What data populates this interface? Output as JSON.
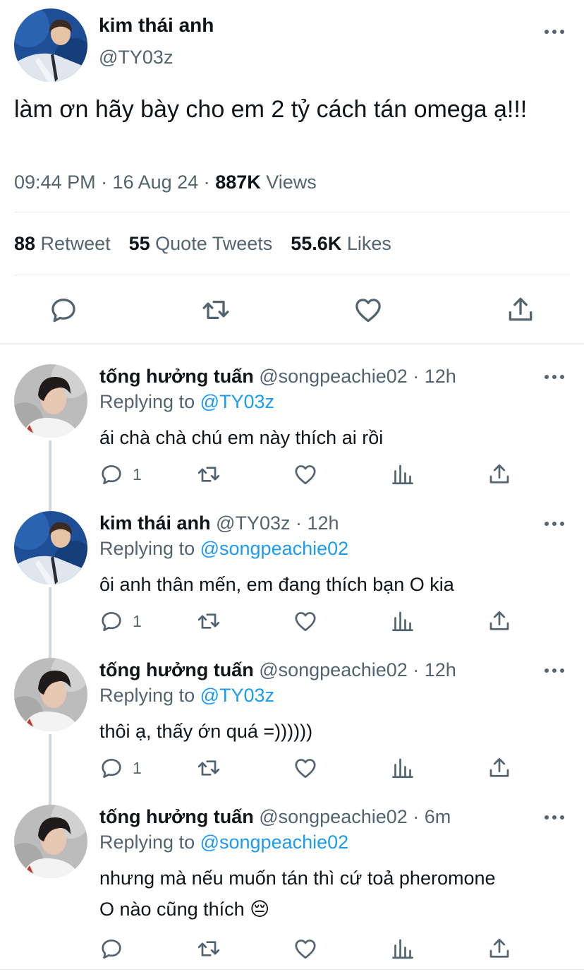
{
  "main_tweet": {
    "name": "kim thái anh",
    "handle": "@TY03z",
    "text": "làm ơn hãy bày cho em 2 tỷ cách tán omega ạ!!!",
    "time": "09:44 PM · 16 Aug 24 · ",
    "views_count": "887K",
    "views_label": " Views",
    "retweets_count": "88",
    "retweets_label": " Retweet",
    "quotes_count": "55",
    "quotes_label": " Quote Tweets",
    "likes_count": "55.6K",
    "likes_label": " Likes"
  },
  "replies": [
    {
      "name": "tống hưởng tuấn",
      "handle_time": " @songpeachie02 · 12h",
      "replying_prefix": "Replying to ",
      "replying_to": "@TY03z",
      "text": "ái chà chà chú em này thích ai rồi",
      "reply_count": "1"
    },
    {
      "name": "kim thái anh",
      "handle_time": " @TY03z · 12h",
      "replying_prefix": "Replying to ",
      "replying_to": "@songpeachie02",
      "text": "ôi anh thân mến, em đang thích bạn O kia",
      "reply_count": "1"
    },
    {
      "name": "tống hưởng tuấn",
      "handle_time": " @songpeachie02 · 12h",
      "replying_prefix": "Replying to ",
      "replying_to": "@TY03z",
      "text": "thôi ạ, thấy ớn quá =))))))",
      "reply_count": "1"
    },
    {
      "name": "tống hưởng tuấn",
      "handle_time": " @songpeachie02 · 6m",
      "replying_prefix": "Replying to ",
      "replying_to": "@songpeachie02",
      "text_line1": "nhưng mà nếu muốn tán thì cứ toả pheromone",
      "text_line2": "O nào cũng thích 😔",
      "reply_count": ""
    }
  ],
  "icons": {
    "reply": "reply-icon",
    "retweet": "retweet-icon",
    "like": "heart-icon",
    "share": "share-icon",
    "analytics": "analytics-icon",
    "more": "more-icon"
  },
  "colors": {
    "text": "#0f1419",
    "muted": "#536471",
    "link": "#1d9bf0",
    "divider": "#e6ecf0"
  }
}
